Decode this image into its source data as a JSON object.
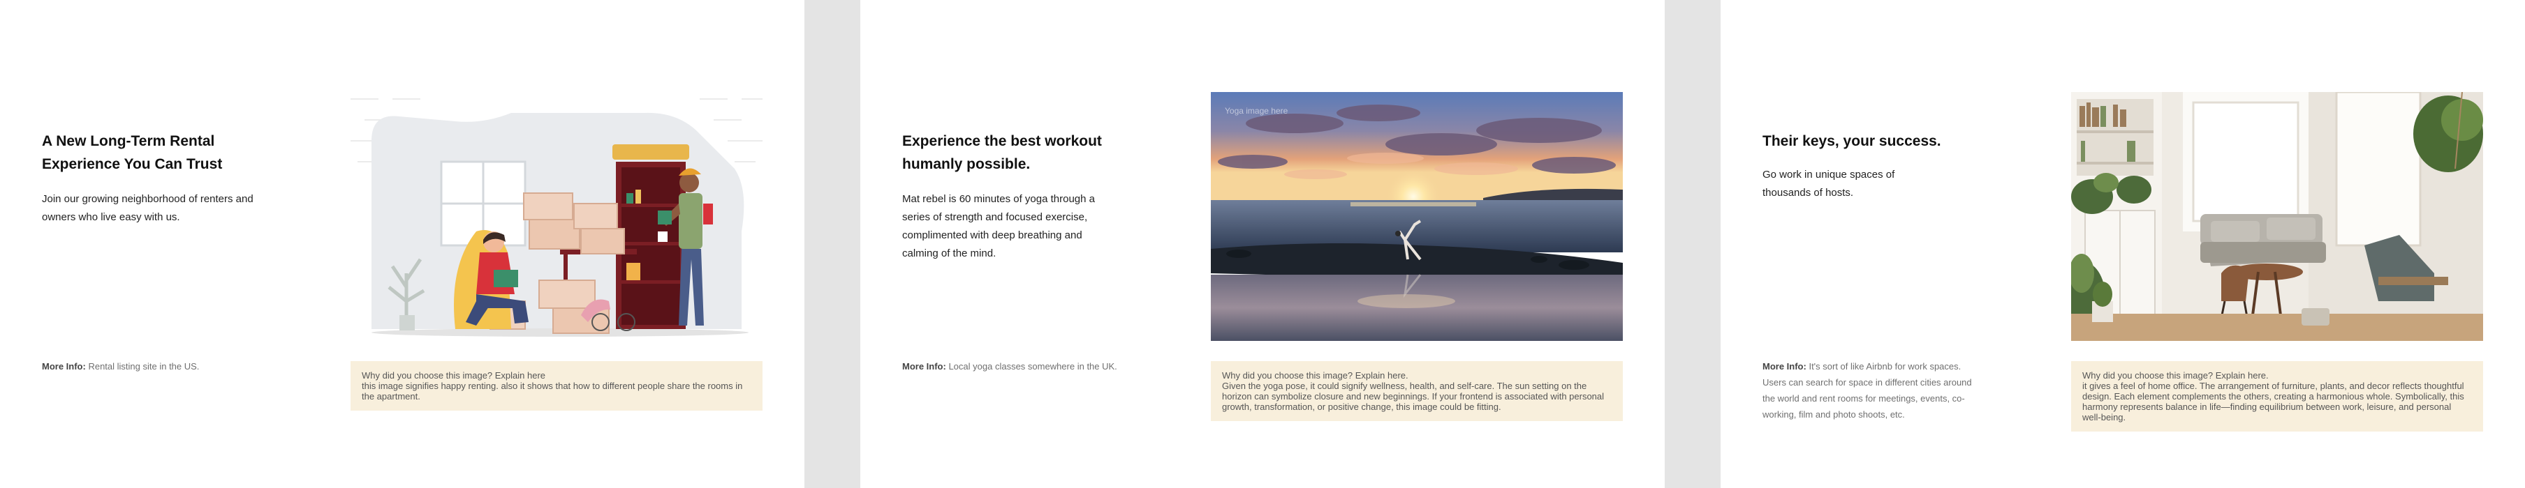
{
  "cards": [
    {
      "title": "A New Long-Term Rental Experience You Can Trust",
      "description": "Join our growing neighborhood of renters and owners who live easy with us.",
      "info_label": "More Info:",
      "info_text": "Rental listing site in the US.",
      "note_question": "Why did you choose this image? Explain here",
      "note_answer": "this image signifies happy renting. also it shows that how to different people share the rooms in the apartment."
    },
    {
      "title": "Experience the best workout humanly possible.",
      "description": "Mat rebel is 60 minutes of yoga through a series of strength and focused exercise, complimented with deep breathing and calming of the mind.",
      "info_label": "More Info:",
      "info_text": "Local yoga classes somewhere in the UK.",
      "photo_label": "Yoga image here",
      "note_question": "Why did you choose this image? Explain here.",
      "note_answer": "Given the yoga pose, it could signify wellness, health, and self-care. The sun setting on the horizon can symbolize closure and new beginnings. If your frontend is associated with personal growth, transformation, or positive change, this image could be fitting."
    },
    {
      "title": "Their keys, your success.",
      "description": "Go work in unique spaces of thousands of hosts.",
      "info_label": "More Info:",
      "info_text": "It's sort of like Airbnb for work spaces. Users can search for space in different cities around the world and rent rooms for meetings, events, co-working, film and photo shoots, etc.",
      "note_question": "Why did you choose this image? Explain here.",
      "note_answer": "it gives a feel of home office. The arrangement of furniture, plants, and decor reflects thoughtful design. Each element complements the others, creating a harmonious whole. Symbolically, this harmony represents balance in life—finding equilibrium between work, leisure, and personal well-being."
    }
  ]
}
